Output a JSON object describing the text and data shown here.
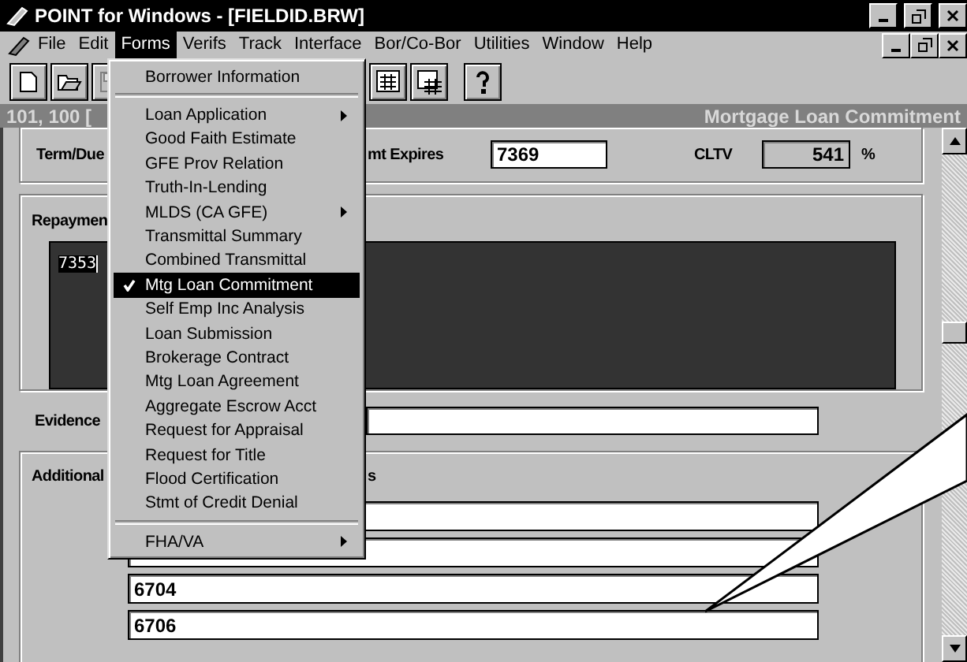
{
  "window": {
    "title": "POINT for Windows - [FIELDID.BRW]"
  },
  "menu_bar": [
    {
      "label": "File",
      "selected": false
    },
    {
      "label": "Edit",
      "selected": false
    },
    {
      "label": "Forms",
      "selected": true
    },
    {
      "label": "Verifs",
      "selected": false
    },
    {
      "label": "Track",
      "selected": false
    },
    {
      "label": "Interface",
      "selected": false
    },
    {
      "label": "Bor/Co-Bor",
      "selected": false
    },
    {
      "label": "Utilities",
      "selected": false
    },
    {
      "label": "Window",
      "selected": false
    },
    {
      "label": "Help",
      "selected": false
    }
  ],
  "toolbar": [
    {
      "kind": "new",
      "disabled": false
    },
    {
      "kind": "open",
      "disabled": false
    },
    {
      "kind": "save",
      "disabled": true
    },
    {
      "kind": "gap"
    },
    {
      "kind": "calculator",
      "disabled": false
    },
    {
      "kind": "grid",
      "disabled": false
    },
    {
      "kind": "help",
      "disabled": false
    }
  ],
  "form_header": {
    "left": "101, 100 [",
    "right": "Mortgage Loan Commitment"
  },
  "terms": {
    "label": "Term/Due",
    "expires_label": "mt Expires",
    "expires_value": "7369",
    "cltv_label": "CLTV",
    "cltv_value": "541",
    "cltv_unit": "%"
  },
  "repayment": {
    "label": "Repaymen",
    "value": "7353"
  },
  "evidence": {
    "label": "Evidence"
  },
  "additional": {
    "label": "Additional",
    "caption": "s",
    "fields": [
      {
        "kind": "blank"
      },
      {
        "kind": "blank"
      },
      {
        "kind": "text",
        "value": "6704"
      },
      {
        "kind": "text",
        "value": "6706"
      }
    ]
  },
  "forms_menu": [
    {
      "kind": "item",
      "label": "Borrower Information",
      "checked": false,
      "selected": false,
      "submenu": false
    },
    {
      "kind": "separator"
    },
    {
      "kind": "item",
      "label": "Loan Application",
      "checked": false,
      "selected": false,
      "submenu": true
    },
    {
      "kind": "item",
      "label": "Good Faith Estimate",
      "checked": false,
      "selected": false,
      "submenu": false
    },
    {
      "kind": "item",
      "label": "GFE Prov Relation",
      "checked": false,
      "selected": false,
      "submenu": false
    },
    {
      "kind": "item",
      "label": "Truth-In-Lending",
      "checked": false,
      "selected": false,
      "submenu": false
    },
    {
      "kind": "item",
      "label": "MLDS (CA GFE)",
      "checked": false,
      "selected": false,
      "submenu": true
    },
    {
      "kind": "item",
      "label": "Transmittal Summary",
      "checked": false,
      "selected": false,
      "submenu": false
    },
    {
      "kind": "item",
      "label": "Combined Transmittal",
      "checked": false,
      "selected": false,
      "submenu": false
    },
    {
      "kind": "item",
      "label": "Mtg Loan Commitment",
      "checked": true,
      "selected": true,
      "submenu": false
    },
    {
      "kind": "item",
      "label": "Self Emp Inc Analysis",
      "checked": false,
      "selected": false,
      "submenu": false
    },
    {
      "kind": "item",
      "label": "Loan Submission",
      "checked": false,
      "selected": false,
      "submenu": false
    },
    {
      "kind": "item",
      "label": "Brokerage Contract",
      "checked": false,
      "selected": false,
      "submenu": false
    },
    {
      "kind": "item",
      "label": "Mtg Loan Agreement",
      "checked": false,
      "selected": false,
      "submenu": false
    },
    {
      "kind": "item",
      "label": "Aggregate Escrow Acct",
      "checked": false,
      "selected": false,
      "submenu": false
    },
    {
      "kind": "item",
      "label": "Request for Appraisal",
      "checked": false,
      "selected": false,
      "submenu": false
    },
    {
      "kind": "item",
      "label": "Request for Title",
      "checked": false,
      "selected": false,
      "submenu": false
    },
    {
      "kind": "item",
      "label": "Flood Certification",
      "checked": false,
      "selected": false,
      "submenu": false
    },
    {
      "kind": "item",
      "label": "Stmt of Credit Denial",
      "checked": false,
      "selected": false,
      "submenu": false
    },
    {
      "kind": "separator"
    },
    {
      "kind": "item",
      "label": "FHA/VA",
      "checked": false,
      "selected": false,
      "submenu": true
    }
  ]
}
